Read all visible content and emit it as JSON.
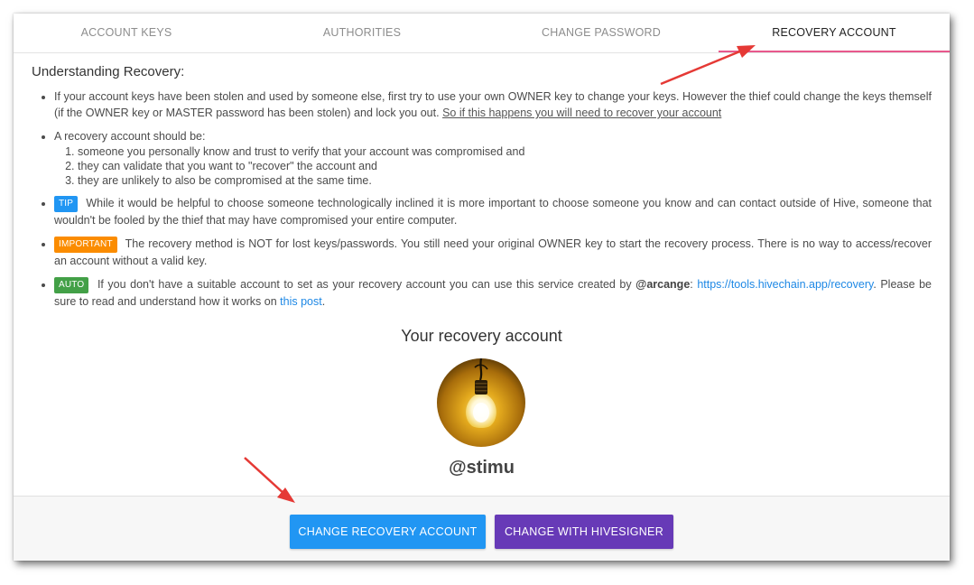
{
  "tabs": [
    {
      "label": "ACCOUNT KEYS",
      "active": false
    },
    {
      "label": "AUTHORITIES",
      "active": false
    },
    {
      "label": "CHANGE PASSWORD",
      "active": false
    },
    {
      "label": "RECOVERY ACCOUNT",
      "active": true
    }
  ],
  "recovery_info": {
    "heading": "Understanding Recovery:",
    "point1": {
      "text": "If your account keys have been stolen and used by someone else, first try to use your own OWNER key to change your keys. However the thief could change the keys themself (if the OWNER key or MASTER password has been stolen) and lock you out.",
      "link": "So if this happens you will need to recover your account"
    },
    "point2": {
      "intro": "A recovery account should be:",
      "items": [
        "someone you personally know and trust to verify that your account was compromised and",
        "they can validate that you want to \"recover\" the account and",
        "they are unlikely to also be compromised at the same time."
      ]
    },
    "tip": {
      "badge": "TIP",
      "text": "While it would be helpful to choose someone technologically inclined it is more important to choose someone you know and can contact outside of Hive, someone that wouldn't be fooled by the thief that may have compromised your entire computer."
    },
    "important": {
      "badge": "IMPORTANT",
      "text": "The recovery method is NOT for lost keys/passwords. You still need your original OWNER key to start the recovery process. There is no way to access/recover an account without a valid key."
    },
    "auto": {
      "badge": "AUTO",
      "text_before": "If you don't have a suitable account to set as your recovery account you can use this service created by",
      "user": "@arcange",
      "colon": ":",
      "link": "https://tools.hivechain.app/recovery",
      "text_middle": ". Please be sure to read and understand how it works on",
      "post_link": "this post",
      "text_end": "."
    }
  },
  "recovery_account": {
    "title": "Your recovery account",
    "username": "@stimu",
    "avatar_icon": "light-bulb-avatar"
  },
  "actions": {
    "change_recovery": "CHANGE RECOVERY ACCOUNT",
    "change_hivesigner": "CHANGE WITH HIVESIGNER"
  },
  "colors": {
    "accent": "#e8588c",
    "primary_button": "#2196f3",
    "secondary_button": "#673ab7",
    "tip": "#2196f3",
    "important": "#fb8c00",
    "auto": "#43a047",
    "annotation_arrow": "#e53935"
  }
}
